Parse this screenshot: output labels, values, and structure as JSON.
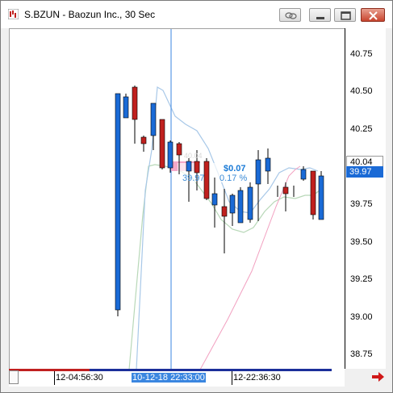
{
  "window": {
    "title": "S.BZUN - Baozun Inc., 30 Sec"
  },
  "price_axis": {
    "ticks": [
      "40.75",
      "40.50",
      "40.25",
      "40.04",
      "39.97",
      "39.75",
      "39.50",
      "39.25",
      "39.00",
      "38.75"
    ],
    "last_price": "40.04",
    "current_price": "39.97"
  },
  "time_axis": {
    "labels": [
      "12-04:56:30",
      "10-12-18 22:33:00",
      "12-22:36:30"
    ],
    "selected": "10-12-18 22:33:00"
  },
  "measure": {
    "change": "$0.07",
    "price": "39.97",
    "percent": "0.17 %",
    "start": "40.04"
  },
  "colors": {
    "up": "#1a6ad6",
    "down": "#c0201e",
    "crosshair": "#3a86e0",
    "ma_fast": "#a8c8e8",
    "ma_slow": "#b8d8b8",
    "trend_line": "#f2a0c0"
  },
  "icons": {
    "app": "chart-app-icon",
    "link": "link-icon",
    "minimize": "minimize-icon",
    "maximize": "maximize-icon",
    "close": "close-icon",
    "scroll_right": "arrow-right-icon"
  }
}
